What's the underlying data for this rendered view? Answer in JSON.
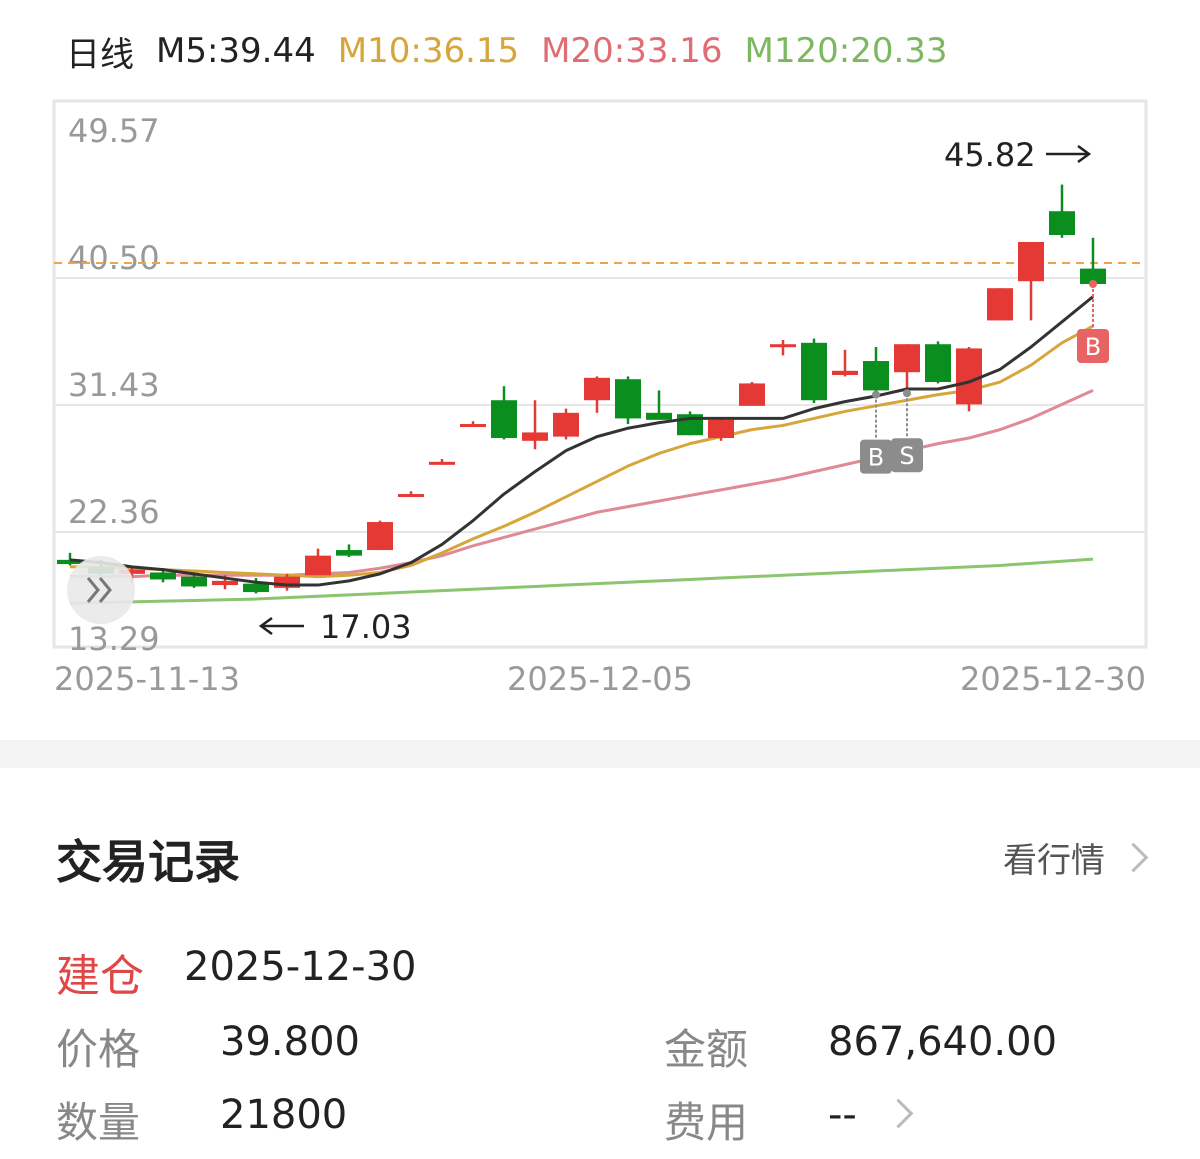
{
  "ma_bar": {
    "period": "日线",
    "items": [
      {
        "label": "M5:39.44",
        "color": "#222222"
      },
      {
        "label": "M10:36.15",
        "color": "#d6a63a"
      },
      {
        "label": "M20:33.16",
        "color": "#e06c75"
      },
      {
        "label": "M120:20.33",
        "color": "#7cb85f"
      }
    ]
  },
  "chart_data": {
    "type": "candlestick",
    "y_ticks": [
      "49.57",
      "40.50",
      "31.43",
      "22.36",
      "13.29"
    ],
    "ylim": [
      13.29,
      49.57
    ],
    "x_labels": [
      "2025-11-13",
      "2025-12-05",
      "2025-12-30"
    ],
    "high_label": "45.82",
    "low_label": "17.03",
    "reference_line": 40.0,
    "colors": {
      "up": "#e53935",
      "down": "#0a8f1e",
      "ma5": "#333333",
      "ma10": "#d6a63a",
      "ma20": "#e08a95",
      "ma120": "#8cc56f",
      "ref": "#f0a050"
    },
    "candles": [
      {
        "o": 18.8,
        "h": 19.3,
        "l": 18.4,
        "c": 18.5
      },
      {
        "o": 18.3,
        "h": 18.8,
        "l": 17.7,
        "c": 17.8
      },
      {
        "o": 17.8,
        "h": 18.3,
        "l": 17.2,
        "c": 18.1
      },
      {
        "o": 17.9,
        "h": 18.2,
        "l": 17.2,
        "c": 17.4
      },
      {
        "o": 17.6,
        "h": 17.8,
        "l": 16.8,
        "c": 16.9
      },
      {
        "o": 17.0,
        "h": 17.7,
        "l": 16.7,
        "c": 17.3
      },
      {
        "o": 17.1,
        "h": 17.5,
        "l": 16.4,
        "c": 16.5
      },
      {
        "o": 16.8,
        "h": 17.8,
        "l": 16.6,
        "c": 17.6
      },
      {
        "o": 17.7,
        "h": 19.6,
        "l": 17.7,
        "c": 19.1
      },
      {
        "o": 19.5,
        "h": 19.9,
        "l": 19.0,
        "c": 19.1
      },
      {
        "o": 19.5,
        "h": 21.6,
        "l": 19.5,
        "c": 21.5
      },
      {
        "o": 23.5,
        "h": 23.7,
        "l": 23.3,
        "c": 23.5
      },
      {
        "o": 25.8,
        "h": 26.0,
        "l": 25.6,
        "c": 25.8
      },
      {
        "o": 28.5,
        "h": 28.7,
        "l": 28.3,
        "c": 28.5
      },
      {
        "o": 30.2,
        "h": 31.2,
        "l": 27.4,
        "c": 27.5
      },
      {
        "o": 27.3,
        "h": 30.2,
        "l": 26.7,
        "c": 27.9
      },
      {
        "o": 27.6,
        "h": 29.6,
        "l": 27.4,
        "c": 29.3
      },
      {
        "o": 30.2,
        "h": 31.9,
        "l": 29.3,
        "c": 31.8
      },
      {
        "o": 31.7,
        "h": 31.9,
        "l": 28.5,
        "c": 28.9
      },
      {
        "o": 29.3,
        "h": 30.9,
        "l": 28.9,
        "c": 28.8
      },
      {
        "o": 29.2,
        "h": 29.4,
        "l": 27.7,
        "c": 27.7
      },
      {
        "o": 27.5,
        "h": 29.0,
        "l": 27.3,
        "c": 28.8
      },
      {
        "o": 29.8,
        "h": 31.5,
        "l": 29.8,
        "c": 31.4
      },
      {
        "o": 34.2,
        "h": 34.5,
        "l": 33.4,
        "c": 34.2
      },
      {
        "o": 34.3,
        "h": 34.6,
        "l": 30.0,
        "c": 30.2
      },
      {
        "o": 32.0,
        "h": 33.8,
        "l": 31.9,
        "c": 32.3
      },
      {
        "o": 33.0,
        "h": 34.0,
        "l": 30.6,
        "c": 30.9
      },
      {
        "o": 32.2,
        "h": 34.2,
        "l": 30.7,
        "c": 34.2
      },
      {
        "o": 34.2,
        "h": 34.4,
        "l": 31.4,
        "c": 31.5
      },
      {
        "o": 29.9,
        "h": 34.0,
        "l": 29.4,
        "c": 33.9
      },
      {
        "o": 35.9,
        "h": 38.2,
        "l": 35.9,
        "c": 38.2
      },
      {
        "o": 38.7,
        "h": 41.5,
        "l": 35.9,
        "c": 41.5
      },
      {
        "o": 43.7,
        "h": 45.6,
        "l": 41.8,
        "c": 42.0
      },
      {
        "o": 39.6,
        "h": 41.8,
        "l": 38.6,
        "c": 38.5
      }
    ],
    "ma5": [
      18.8,
      18.6,
      18.3,
      18.1,
      17.8,
      17.5,
      17.2,
      17.0,
      17.0,
      17.3,
      17.8,
      18.6,
      19.9,
      21.6,
      23.5,
      25.1,
      26.6,
      27.6,
      28.2,
      28.6,
      28.9,
      28.9,
      28.9,
      28.9,
      29.6,
      30.1,
      30.5,
      31.0,
      31.0,
      31.5,
      32.4,
      34.0,
      35.8,
      37.6
    ],
    "ma10": [
      18.3,
      18.3,
      18.2,
      18.1,
      18.0,
      17.9,
      17.8,
      17.7,
      17.6,
      17.7,
      17.9,
      18.4,
      19.3,
      20.3,
      21.2,
      22.2,
      23.3,
      24.4,
      25.5,
      26.4,
      27.1,
      27.6,
      28.1,
      28.4,
      28.9,
      29.4,
      29.8,
      30.2,
      30.6,
      30.9,
      31.5,
      32.7,
      34.3,
      35.5
    ],
    "ma20": [
      17.6,
      17.6,
      17.6,
      17.7,
      17.7,
      17.7,
      17.7,
      17.7,
      17.8,
      17.9,
      18.2,
      18.6,
      19.1,
      19.8,
      20.4,
      21.0,
      21.6,
      22.2,
      22.6,
      23.0,
      23.4,
      23.8,
      24.2,
      24.6,
      25.1,
      25.6,
      26.1,
      26.6,
      27.1,
      27.5,
      28.1,
      28.9,
      29.9,
      30.9
    ],
    "ma120": [
      15.7,
      15.75,
      15.8,
      15.85,
      15.9,
      15.95,
      16.0,
      16.1,
      16.2,
      16.3,
      16.4,
      16.5,
      16.6,
      16.7,
      16.8,
      16.9,
      17.0,
      17.1,
      17.2,
      17.3,
      17.4,
      17.5,
      17.6,
      17.7,
      17.8,
      17.9,
      18.0,
      18.1,
      18.2,
      18.3,
      18.4,
      18.55,
      18.7,
      18.85
    ],
    "markers": [
      {
        "index": 26,
        "label": "B",
        "color": "#8c8c8c",
        "anchor": 30.6,
        "pos": "below"
      },
      {
        "index": 27,
        "label": "S",
        "color": "#8c8c8c",
        "anchor": 30.7,
        "pos": "below"
      },
      {
        "index": 33,
        "label": "B",
        "color": "#e86464",
        "anchor": 38.5,
        "pos": "below"
      }
    ]
  },
  "trade_record": {
    "title": "交易记录",
    "market_link": "看行情",
    "type": "建仓",
    "date": "2025-12-30",
    "price_label": "价格",
    "price": "39.800",
    "amount_label": "金额",
    "amount": "867,640.00",
    "qty_label": "数量",
    "qty": "21800",
    "fee_label": "费用",
    "fee": "--"
  }
}
